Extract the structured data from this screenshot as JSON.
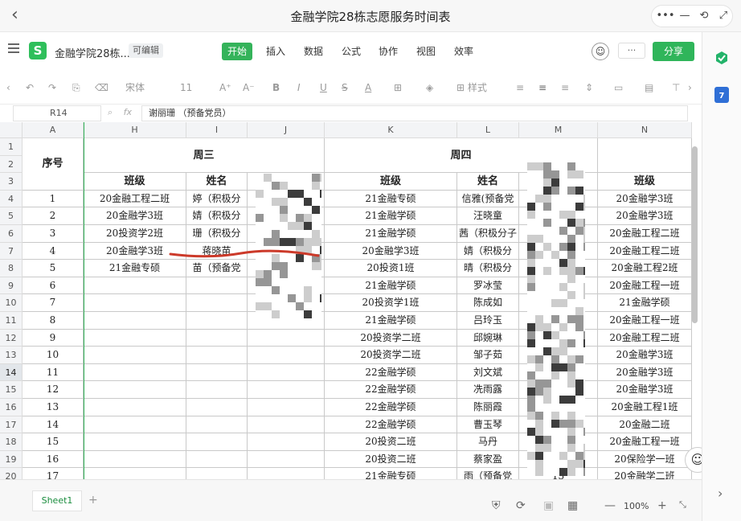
{
  "window": {
    "title": "金融学院28栋志愿服务时间表",
    "back_icon": "‹",
    "controls": [
      "•••",
      "—",
      "⟲",
      "⤢"
    ]
  },
  "menu": {
    "doc_name": "金融学院28栋...",
    "editable_badge": "可编辑",
    "tabs": [
      "开始",
      "插入",
      "数据",
      "公式",
      "协作",
      "视图",
      "效率"
    ],
    "active_tab": "开始",
    "more_label": "···",
    "share_label": "分享"
  },
  "toolbar": {
    "font_name": "宋体",
    "font_size": "11",
    "style_label": "样式"
  },
  "formula_bar": {
    "cell_ref": "R14",
    "fx_label": "fx",
    "content": "谢丽珊 （预备党员）"
  },
  "columns": [
    "A",
    "H",
    "I",
    "J",
    "K",
    "L",
    "M",
    "N"
  ],
  "rows": [
    "1",
    "2",
    "3",
    "4",
    "5",
    "6",
    "7",
    "8",
    "9",
    "10",
    "11",
    "12",
    "13",
    "14",
    "15",
    "16",
    "17",
    "18",
    "19",
    "20"
  ],
  "selected_row": "14",
  "table": {
    "col_seq": "序号",
    "day_wed": "周三",
    "day_thu": "周四",
    "hdr_class": "班级",
    "hdr_name": "姓名",
    "hdr_contact": "联系方式",
    "hdr_class_n": "班级",
    "seq": [
      "1",
      "2",
      "3",
      "4",
      "5",
      "6",
      "7",
      "8",
      "9",
      "10",
      "11",
      "12",
      "13",
      "14",
      "15",
      "16",
      "17"
    ],
    "wed_class": [
      "20金融工程二班",
      "20金融学3班",
      "20投资学2班",
      "20金融学3班",
      "21金融专硕"
    ],
    "wed_name": [
      "婷（积极分",
      "婧（积极分",
      "珊（积极分",
      "蒋晓苗",
      "苗（预备党"
    ],
    "wed_contact": [
      "15 202",
      "0",
      "",
      "",
      ""
    ],
    "thu_class": [
      "21金融专硕",
      "21金融学硕",
      "21金融学硕",
      "20金融学3班",
      "20投资1班",
      "21金融学硕",
      "20投资学1班",
      "21金融学硕",
      "20投资学二班",
      "20投资学二班",
      "22金融学硕",
      "22金融学硕",
      "22金融学硕",
      "22金融学硕",
      "20投资二班",
      "20投资二班",
      "21金融专硕"
    ],
    "thu_name": [
      "信雅(预备党",
      "汪晓童",
      "茜（积极分子",
      "婧（积极分",
      "晴（积极分",
      "罗冰莹",
      "陈成如",
      "吕玲玉",
      "邱婉琳",
      "邹子茹",
      "刘文斌",
      "冼雨露",
      "陈丽霞",
      "曹玉琴",
      "马丹",
      "蔡家盈",
      "雨（预备党"
    ],
    "thu_contact": [
      "1 552",
      "1 0",
      "5",
      "0",
      "9",
      "",
      "18 25",
      "19 54",
      "19 15",
      "20 567",
      "17 379",
      "17 845",
      "18 745",
      "15 605",
      "13 548",
      "13 25",
      "13"
    ],
    "n_class": [
      "20金融学3班",
      "20金融学3班",
      "20金融工程二班",
      "20金融工程二班",
      "20金融工程2班",
      "20金融工程一班",
      "21金融学硕",
      "20金融工程一班",
      "20金融工程二班",
      "20金融学3班",
      "20金融学3班",
      "20金融学3班",
      "20金融工程1班",
      "20金融二班",
      "20金融工程一班",
      "20保险学一班",
      "20金融学二班"
    ]
  },
  "sheet": {
    "tab_name": "Sheet1",
    "add_label": "+",
    "zoom": "100%",
    "zoom_out": "—",
    "zoom_in": "+"
  },
  "colors": {
    "accent_green": "#34b35a",
    "pen_red": "#cc3a2a"
  }
}
